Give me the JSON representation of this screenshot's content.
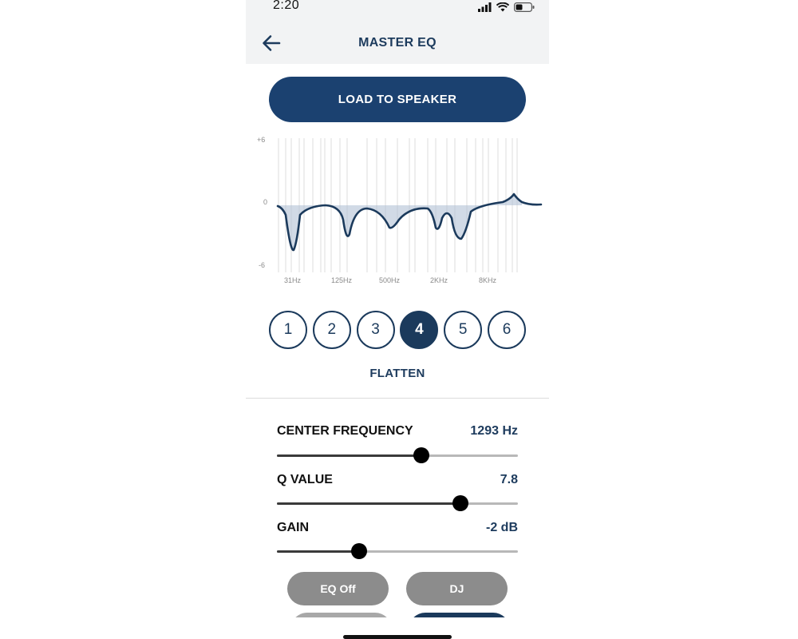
{
  "status": {
    "time": "2:20"
  },
  "header": {
    "title": "MASTER EQ"
  },
  "load_button": {
    "label": "LOAD TO SPEAKER"
  },
  "graph": {
    "y_labels": [
      "+6",
      "0",
      "-6"
    ],
    "x_labels": [
      "31Hz",
      "125Hz",
      "500Hz",
      "2KHz",
      "8KHz"
    ]
  },
  "bands": {
    "items": [
      "1",
      "2",
      "3",
      "4",
      "5",
      "6"
    ],
    "active": "4"
  },
  "flatten_label": "FLATTEN",
  "params": {
    "center_frequency": {
      "label": "CENTER FREQUENCY",
      "value": "1293 Hz",
      "level": 0.6
    },
    "q_value": {
      "label": "Q VALUE",
      "value": "7.8",
      "level": 0.76
    },
    "gain": {
      "label": "GAIN",
      "value": "-2 dB",
      "level": 0.34
    }
  },
  "presets": [
    {
      "label": "EQ Off"
    },
    {
      "label": "DJ"
    }
  ],
  "colors": {
    "accent": "#1b4170",
    "text_dark": "#1d3b5d",
    "preset_gray": "#8c8c8c",
    "header_bg": "#f2f3f4"
  }
}
